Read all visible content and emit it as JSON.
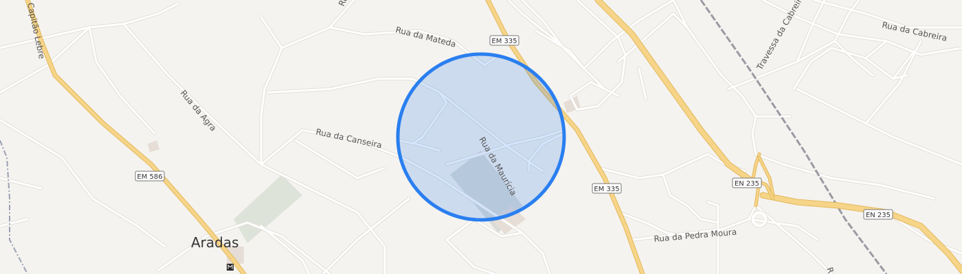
{
  "map": {
    "place": "Aradas",
    "streets": {
      "capitao_lebre": "Capitão Lebre",
      "rua_da_agra": "Rua da Agra",
      "rua_da_mateda": "Rua da Mateda",
      "rua_da_canseira": "Rua da Canseira",
      "rua_da_mauricia": "Rua da Maurícia",
      "rua_da_pedra_moura": "Rua da Pedra Moura",
      "travessa_da_cabreira": "Travessa da Cabreira",
      "rua_da_cabreira": "Rua da Cabreira",
      "rua_top_partial": "Ru",
      "rua_bottom_partial": "R"
    },
    "shields": {
      "em335_top": "EM 335",
      "em335_mid": "EM 335",
      "em586": "EM 586",
      "en235_a": "EN 235",
      "en235_b": "EN 235"
    },
    "colors": {
      "background": "#f5f3ef",
      "minor_road": "#ffffff",
      "major_road": "#f6d488",
      "major_road_casing": "#e2b85c",
      "railway": "#9a9aa3",
      "park": "#dde3d9",
      "building": "#e6ddd6",
      "circle_fill": "#2f7cf0",
      "circle_stroke": "#2a7ff0"
    },
    "icons": {
      "place_marker": "metro-icon"
    }
  }
}
